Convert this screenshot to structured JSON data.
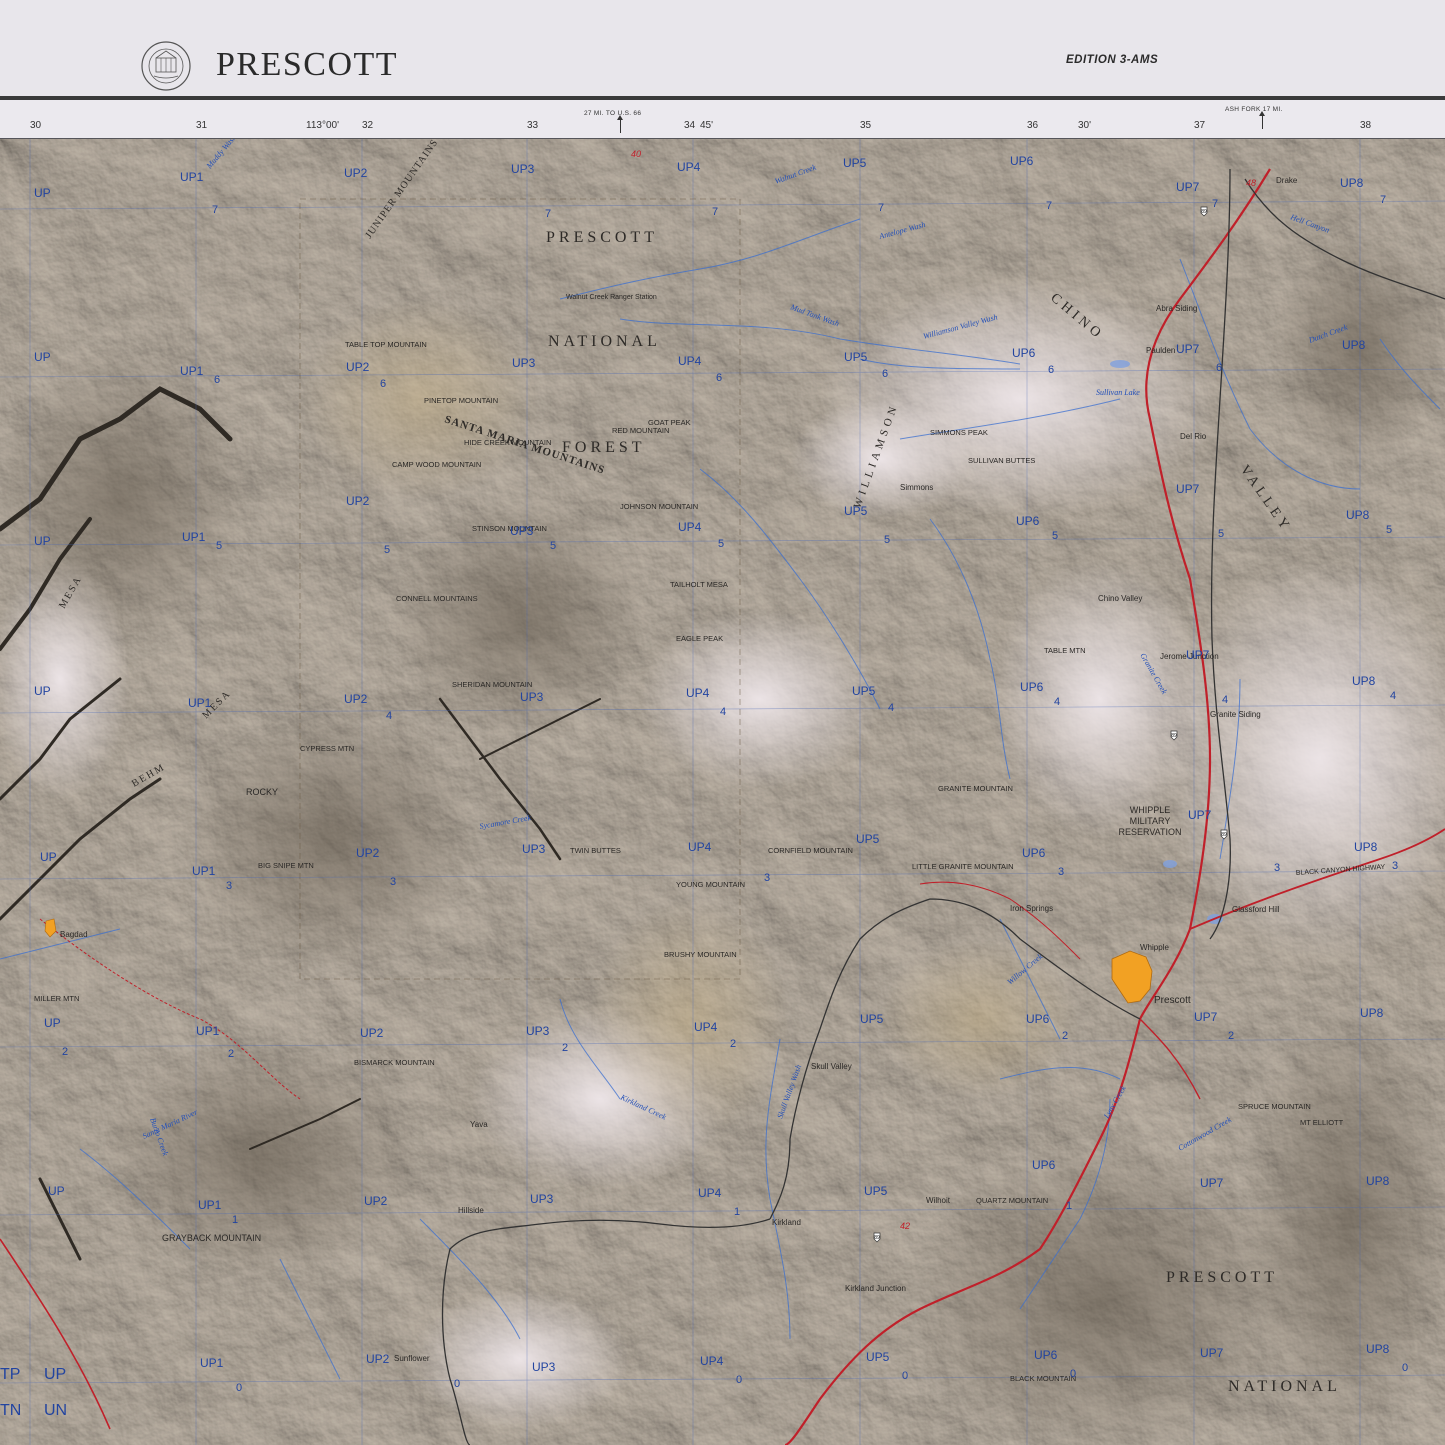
{
  "header": {
    "title": "PRESCOTT",
    "edition": "EDITION 3-AMS",
    "note_route66": "27 MI. TO U.S. 66",
    "note_ashfork": "ASH FORK 17 MI."
  },
  "grid_top": [
    "30",
    "31",
    "113°00'",
    "32",
    "33",
    "34",
    "45'",
    "35",
    "36",
    "30'",
    "37",
    "38"
  ],
  "grid_zones": [
    "UP",
    "UP1",
    "UP2",
    "UP3",
    "UP4",
    "UP5",
    "UP6",
    "UP7",
    "UP8",
    "TP",
    "TN",
    "UN"
  ],
  "grid_numbers": [
    "7",
    "6",
    "5",
    "4",
    "3",
    "2",
    "1",
    "0"
  ],
  "map_labels": {
    "big": [
      "PRESCOTT",
      "NATIONAL",
      "FOREST",
      "SANTA MARIA MOUNTAINS",
      "JUNIPER MOUNTAINS",
      "CHINO",
      "VALLEY",
      "WILLIAMSON",
      "PRESCOTT",
      "NATIONAL",
      "MESA",
      "BEHM",
      "MESA"
    ],
    "towns": [
      "Bagdad",
      "Prescott",
      "Chino Valley",
      "Paulden",
      "Drake",
      "Kirkland",
      "Kirkland Junction",
      "Skull Valley",
      "Hillside",
      "Sunflower",
      "Yava",
      "Wilhoit",
      "Simmons",
      "Whipple",
      "Glassford Hill",
      "Iron Springs",
      "Granite Siding",
      "Del Rio",
      "Jerome Junction",
      "Abra Siding"
    ],
    "mountains": [
      "GRAYBACK MOUNTAIN",
      "BISMARCK MOUNTAIN",
      "TABLE TOP MOUNTAIN",
      "CAMP WOOD MOUNTAIN",
      "CONNELL MOUNTAINS",
      "SHERIDAN MOUNTAIN",
      "GRANITE MOUNTAIN",
      "LITTLE GRANITE MOUNTAIN",
      "BRUSHY MOUNTAIN",
      "TAILHOLT MESA",
      "EAGLE PEAK",
      "CYPRESS MTN",
      "ROCKY",
      "BLACK MOUNTAIN",
      "QUARTZ MOUNTAIN",
      "SPRUCE MOUNTAIN",
      "MT ELLIOTT",
      "TABLE MTN",
      "SULLIVAN BUTTES",
      "SIMMONS PEAK",
      "GOAT PEAK",
      "RED MOUNTAIN",
      "YOUNG MOUNTAIN",
      "CORNFIELD MOUNTAIN",
      "TWIN BUTTES",
      "STINSON MOUNTAIN",
      "JOHNSON MOUNTAIN",
      "BIG SNIPE MTN",
      "MILLER MTN",
      "HIDE CREEK MOUNTAIN",
      "PINETOP MOUNTAIN"
    ],
    "reservation": [
      "WHIPPLE",
      "MILITARY",
      "RESERVATION"
    ],
    "waters": [
      "Walnut Creek",
      "Mud Tank Wash",
      "Antelope Wash",
      "Williamson Valley Wash",
      "Hell Canyon",
      "Sycamore Creek",
      "Skull Valley Wash",
      "Granite Creek",
      "Kirkland Creek",
      "Burro Creek",
      "Santa Maria River",
      "Sullivan Lake",
      "Willow Creek",
      "Lynx Creek",
      "Walnut Creek Ranger Station",
      "Muddy Wash",
      "Cottonwood Creek",
      "Dutch Creek"
    ],
    "highways": [
      "89",
      "89",
      "89",
      "89",
      "42",
      "48",
      "40"
    ],
    "highway_names": [
      "BLACK CANYON HIGHWAY"
    ]
  }
}
